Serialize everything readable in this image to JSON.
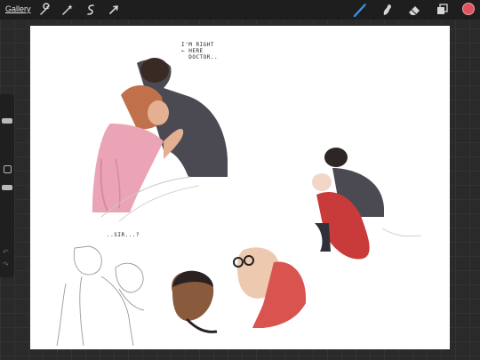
{
  "toolbar": {
    "gallery_label": "Gallery",
    "left_tools": [
      "wrench-icon",
      "magic-wand-icon",
      "selection-icon",
      "transform-icon"
    ],
    "right_tools": [
      "brush-icon",
      "smudge-icon",
      "eraser-icon",
      "layers-icon"
    ],
    "active_tool": "brush-icon",
    "current_color": "#e05260",
    "brush_color": "#3f8fe0"
  },
  "sidebar": {
    "brush_size_level": 0.15,
    "opacity_level": 0.6,
    "modify_label": "",
    "undo_icon": "undo-icon",
    "redo_icon": "redo-icon"
  },
  "canvas": {
    "note_1": "I'M RIGHT\n← HERE\n  DOCTOR..",
    "note_2": "..SIR...?"
  }
}
